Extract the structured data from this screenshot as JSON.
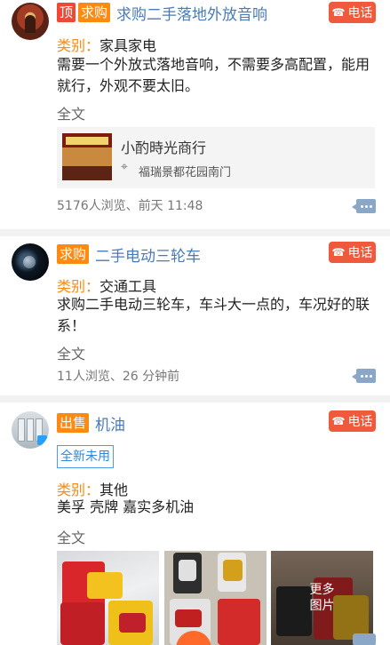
{
  "posts": [
    {
      "tags": [
        "顶",
        "求购"
      ],
      "title": "求购二手落地外放音响",
      "call_label": "电话",
      "category_key": "类别：",
      "category_value": "家具家电",
      "description": "需要一个外放式落地音响，不需要多高配置，能用就行，外观不要太旧。",
      "full_text_label": "全文",
      "shop": {
        "name": "小酌時光商行",
        "address": "福瑞景都花园南门"
      },
      "stats": "5176人浏览、前天 11:48"
    },
    {
      "tags": [
        "求购"
      ],
      "title": "二手电动三轮车",
      "call_label": "电话",
      "category_key": "类别：",
      "category_value": "交通工具",
      "description": "求购二手电动三轮车，车斗大一点的，车况好的联系！",
      "full_text_label": "全文",
      "stats": "11人浏览、26 分钟前"
    },
    {
      "tags": [
        "出售"
      ],
      "title": "机油",
      "call_label": "电话",
      "condition_tag": "全新未用",
      "category_key": "类别：",
      "category_value": "其他",
      "description": "美孚 壳牌 嘉实多机油",
      "full_text_label": "全文",
      "more_photos_label_line1": "更多",
      "more_photos_label_line2": "图片"
    }
  ],
  "colors": {
    "accent_orange": "#ff8a12",
    "top_red": "#ee4937",
    "call_red": "#f05a3c",
    "title_blue": "#4a7bb4",
    "link_blue": "#2f86de"
  },
  "icons": {
    "call": "phone-icon",
    "message": "comment-icon",
    "location": "location-pin-icon"
  }
}
